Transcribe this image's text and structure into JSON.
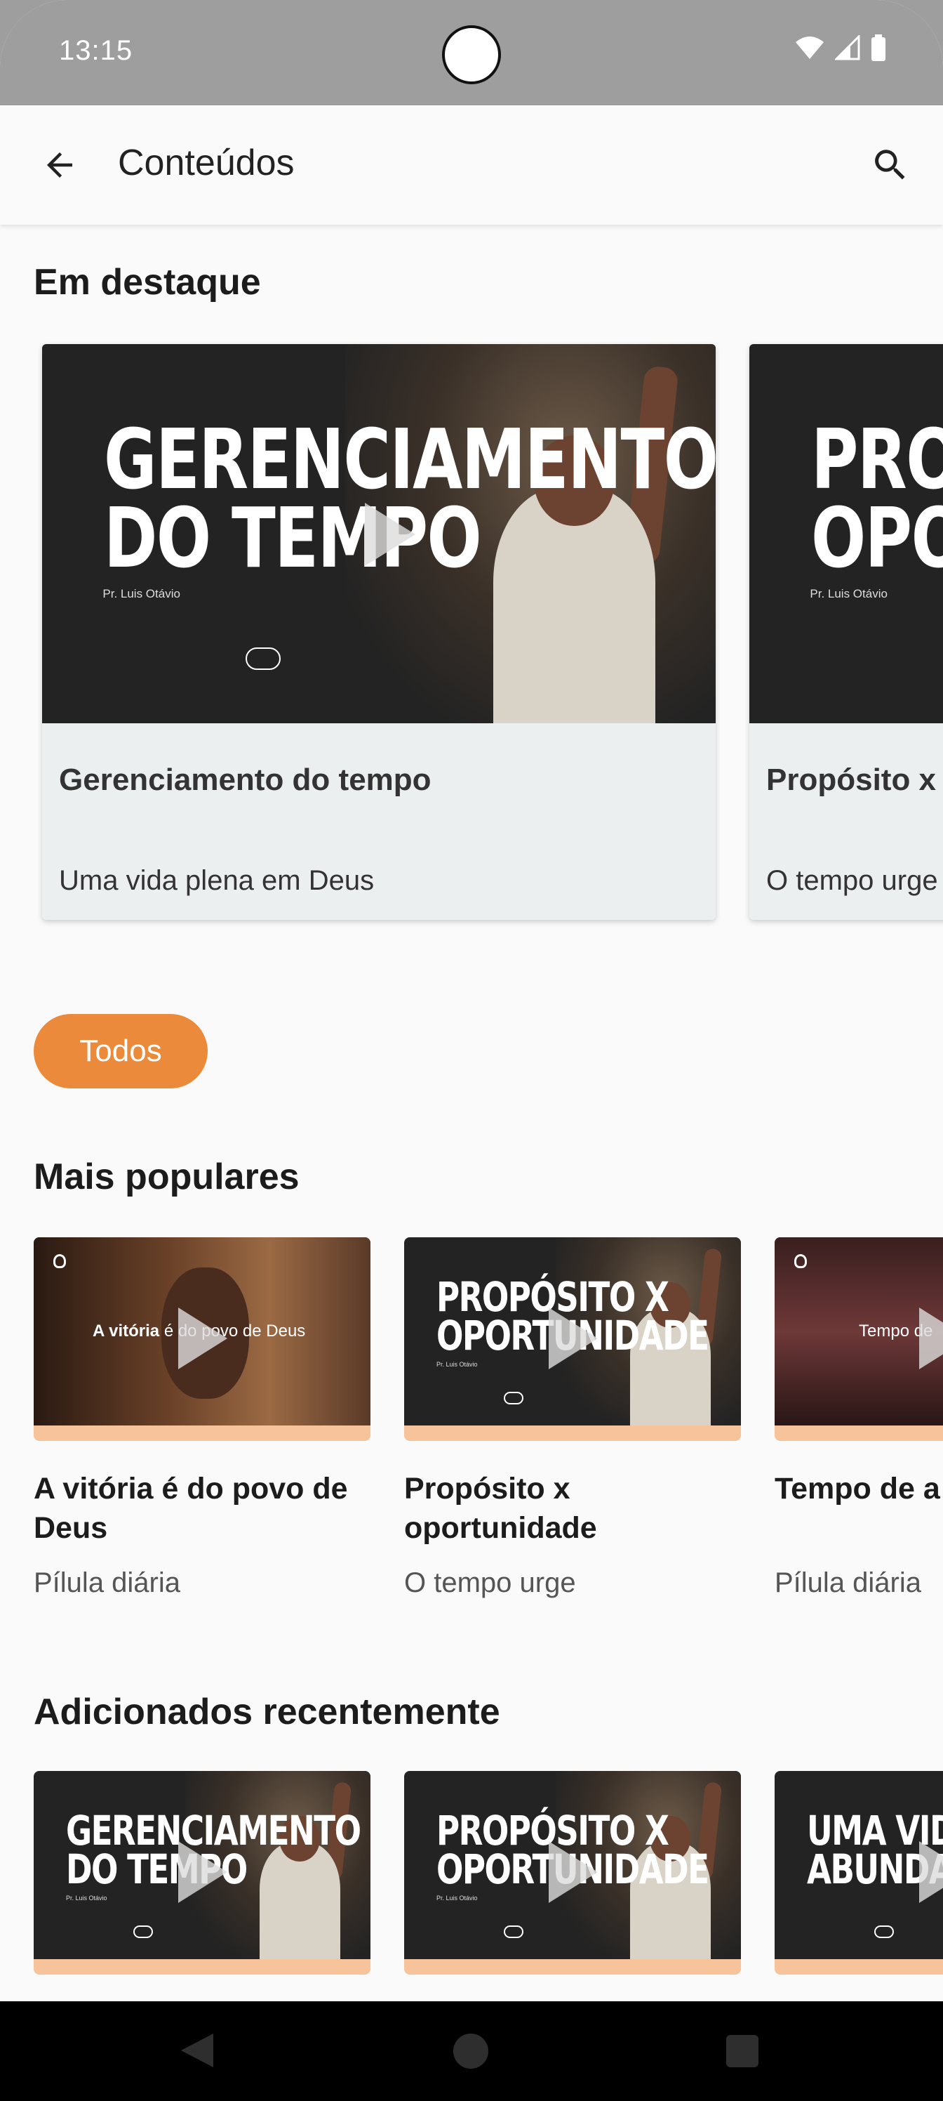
{
  "status_bar": {
    "time": "13:15"
  },
  "app_bar": {
    "title": "Conteúdos"
  },
  "featured": {
    "title": "Em destaque",
    "cards": [
      {
        "headline_line1": "GERENCIAMENTO",
        "headline_line2": "DO TEMPO",
        "author": "Pr. Luis Otávio",
        "title": "Gerenciamento do tempo",
        "subtitle": "Uma vida plena em Deus"
      },
      {
        "headline_line1": "PROP",
        "headline_line2": "OPOR",
        "author": "Pr. Luis Otávio",
        "title": "Propósito x",
        "subtitle": "O tempo urge"
      }
    ]
  },
  "filter_chip": {
    "label": "Todos"
  },
  "popular": {
    "title": "Mais populares",
    "cards": [
      {
        "overlay_bold": "A vitória",
        "overlay_rest": "é do povo de Deus",
        "title": "A vitória é do povo de Deus",
        "subtitle": "Pílula diária"
      },
      {
        "headline_line1": "PROPÓSITO X",
        "headline_line2": "OPORTUNIDADE",
        "author": "Pr. Luis Otávio",
        "title": "Propósito x oportunidade",
        "subtitle": "O tempo urge"
      },
      {
        "overlay_rest": "Tempo de",
        "title": "Tempo de a",
        "subtitle": "Pílula diária"
      }
    ]
  },
  "recent": {
    "title": "Adicionados recentemente",
    "cards": [
      {
        "headline_line1": "GERENCIAMENTO",
        "headline_line2": "DO TEMPO",
        "author": "Pr. Luis Otávio"
      },
      {
        "headline_line1": "PROPÓSITO X",
        "headline_line2": "OPORTUNIDADE",
        "author": "Pr. Luis Otávio"
      },
      {
        "headline_line1": "UMA VIDA",
        "headline_line2": "ABUNDANT",
        "author": ""
      }
    ]
  },
  "colors": {
    "accent": "#eb8a3a",
    "thumb_bar": "#f6c39a",
    "status_bar": "#9e9e9e"
  }
}
